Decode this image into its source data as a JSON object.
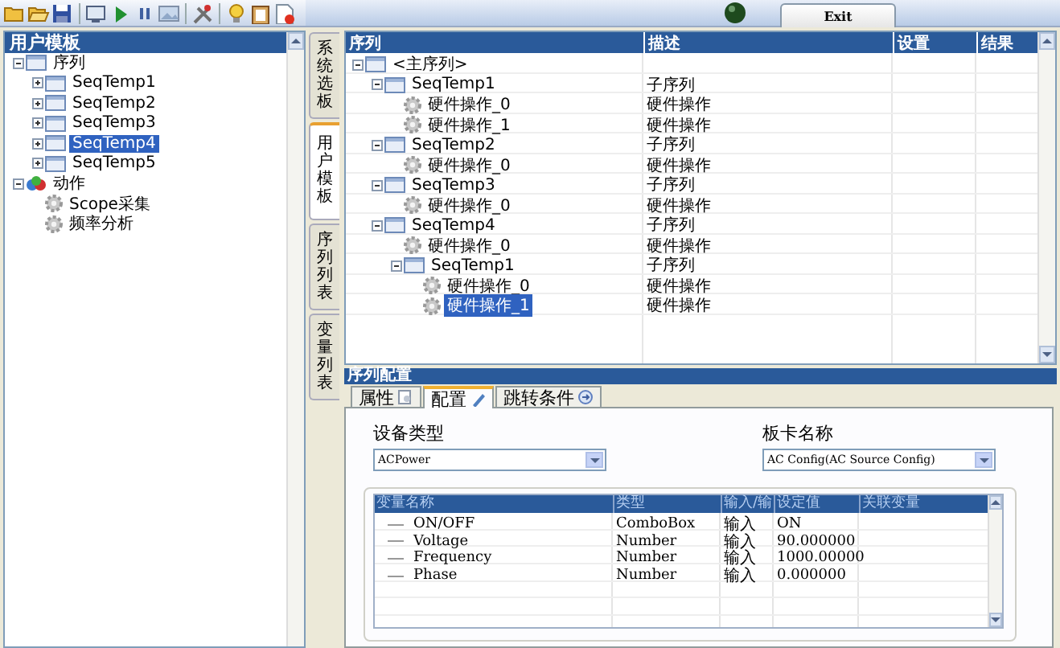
{
  "toolbar": {
    "exit_button": "Exit"
  },
  "template_panel": {
    "title": "用户模板",
    "items": [
      {
        "label": "序列",
        "kind": "sequence",
        "expanded": true,
        "selected": false,
        "children": [
          {
            "label": "SeqTemp1",
            "kind": "sequence",
            "expanded": false,
            "selected": false
          },
          {
            "label": "SeqTemp2",
            "kind": "sequence",
            "expanded": false,
            "selected": false
          },
          {
            "label": "SeqTemp3",
            "kind": "sequence",
            "expanded": false,
            "selected": false
          },
          {
            "label": "SeqTemp4",
            "kind": "sequence",
            "expanded": false,
            "selected": true
          },
          {
            "label": "SeqTemp5",
            "kind": "sequence",
            "expanded": false,
            "selected": false
          }
        ]
      },
      {
        "label": "动作",
        "kind": "action",
        "expanded": true,
        "selected": false,
        "children": [
          {
            "label": "Scope采集",
            "kind": "operation",
            "selected": false
          },
          {
            "label": "频率分析",
            "kind": "operation",
            "selected": false
          }
        ]
      }
    ]
  },
  "side_tabs": [
    {
      "label": "系统选板",
      "selected": false
    },
    {
      "label": "用户模板",
      "selected": true
    },
    {
      "label": "序列列表",
      "selected": false
    },
    {
      "label": "变量列表",
      "selected": false
    }
  ],
  "sequence_grid": {
    "columns": [
      "序列",
      "描述",
      "设置",
      "结果"
    ],
    "rows": [
      {
        "name": "<主序列>",
        "kind": "sequence",
        "expanded": true,
        "selected": false,
        "children": [
          {
            "name": "SeqTemp1",
            "description": "子序列",
            "kind": "sequence",
            "expanded": true,
            "selected": false,
            "children": [
              {
                "name": "硬件操作_0",
                "description": "硬件操作",
                "kind": "operation",
                "selected": false
              },
              {
                "name": "硬件操作_1",
                "description": "硬件操作",
                "kind": "operation",
                "selected": false
              }
            ]
          },
          {
            "name": "SeqTemp2",
            "description": "子序列",
            "kind": "sequence",
            "expanded": true,
            "selected": false,
            "children": [
              {
                "name": "硬件操作_0",
                "description": "硬件操作",
                "kind": "operation",
                "selected": false
              }
            ]
          },
          {
            "name": "SeqTemp3",
            "description": "子序列",
            "kind": "sequence",
            "expanded": true,
            "selected": false,
            "children": [
              {
                "name": "硬件操作_0",
                "description": "硬件操作",
                "kind": "operation",
                "selected": false
              }
            ]
          },
          {
            "name": "SeqTemp4",
            "description": "子序列",
            "kind": "sequence",
            "expanded": true,
            "selected": false,
            "children": [
              {
                "name": "硬件操作_0",
                "description": "硬件操作",
                "kind": "operation",
                "selected": false
              },
              {
                "name": "SeqTemp1",
                "description": "子序列",
                "kind": "sequence",
                "expanded": true,
                "selected": false,
                "children": [
                  {
                    "name": "硬件操作_0",
                    "description": "硬件操作",
                    "kind": "operation",
                    "selected": false
                  },
                  {
                    "name": "硬件操作_1",
                    "description": "硬件操作",
                    "kind": "operation",
                    "selected": true
                  }
                ]
              }
            ]
          }
        ]
      }
    ]
  },
  "config": {
    "title": "序列配置",
    "tabs": [
      {
        "label": "属性",
        "selected": false
      },
      {
        "label": "配置",
        "selected": true
      },
      {
        "label": "跳转条件",
        "selected": false
      }
    ],
    "device_type": {
      "label": "设备类型",
      "value": "ACPower"
    },
    "board_name": {
      "label": "板卡名称",
      "value": "AC Config(AC Source Config)"
    },
    "variables": {
      "columns": [
        "变量名称",
        "类型",
        "输入/输",
        "设定值",
        "关联变量"
      ],
      "rows": [
        {
          "name": "ON/OFF",
          "type": "ComboBox",
          "direction": "输入",
          "value": "ON"
        },
        {
          "name": "Voltage",
          "type": "Number",
          "direction": "输入",
          "value": "90.000000"
        },
        {
          "name": "Frequency",
          "type": "Number",
          "direction": "输入",
          "value": "1000.00000"
        },
        {
          "name": "Phase",
          "type": "Number",
          "direction": "输入",
          "value": "0.000000"
        }
      ]
    }
  }
}
